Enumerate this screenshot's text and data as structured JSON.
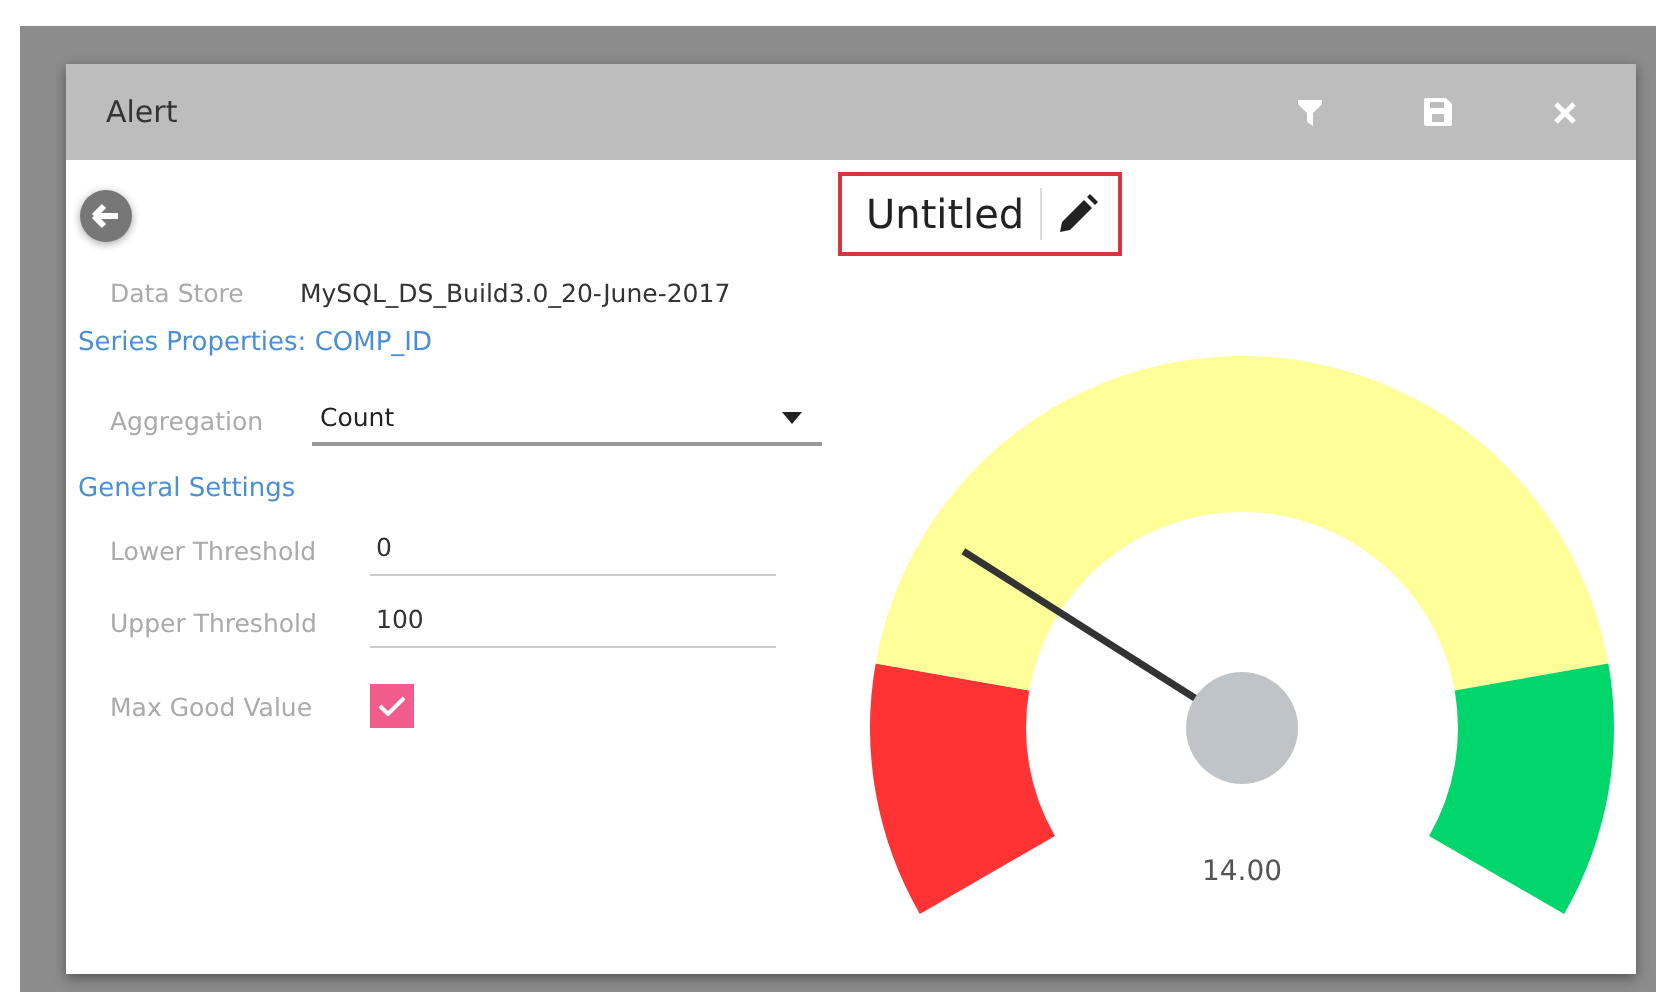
{
  "window": {
    "title": "Alert"
  },
  "title_box": {
    "title": "Untitled"
  },
  "data_store": {
    "label": "Data Store",
    "value": "MySQL_DS_Build3.0_20-June-2017"
  },
  "sections": [
    {
      "heading": "Series Properties: COMP_ID",
      "fields": [
        {
          "kind": "dropdown",
          "label": "Aggregation",
          "value": "Count"
        }
      ]
    },
    {
      "heading": "General Settings",
      "fields": [
        {
          "kind": "text",
          "label": "Lower Threshold",
          "value": "0"
        },
        {
          "kind": "text",
          "label": "Upper Threshold",
          "value": "100"
        },
        {
          "kind": "checkbox",
          "label": "Max Good Value",
          "checked": true
        }
      ]
    }
  ],
  "gauge": {
    "reading": "14.00",
    "level": 0.26,
    "bands": [
      {
        "color": "#ff3333"
      },
      {
        "color": "#ffff99"
      },
      {
        "color": "#00d66c"
      }
    ]
  }
}
